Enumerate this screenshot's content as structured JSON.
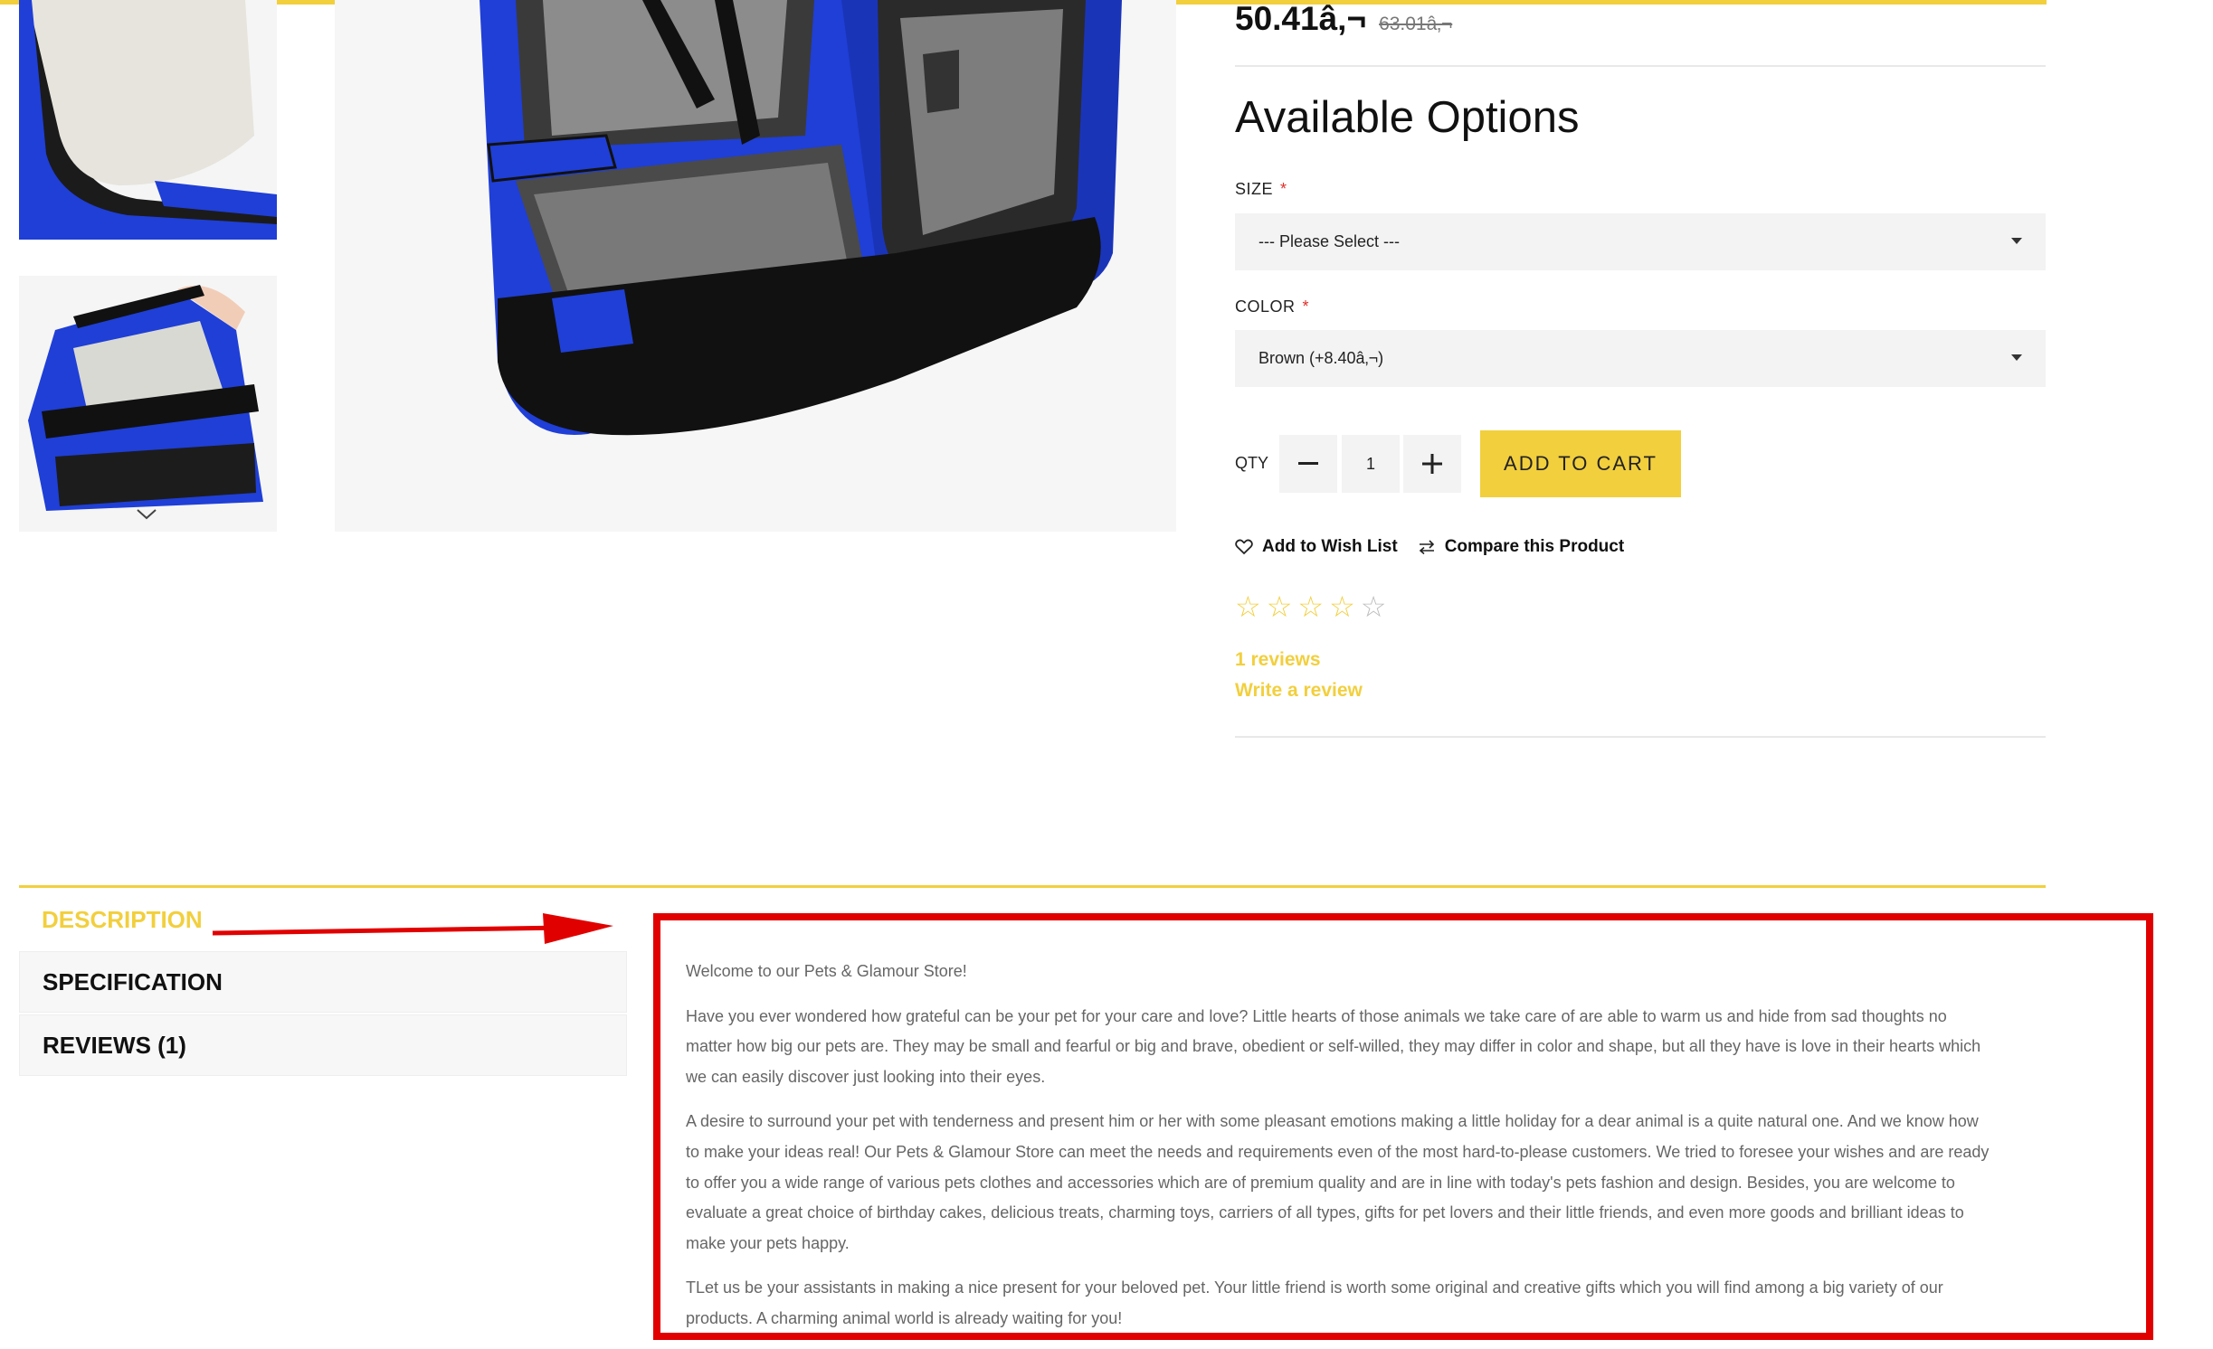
{
  "product": {
    "price_new": "50.41â‚¬",
    "price_old": "63.01â‚¬"
  },
  "options": {
    "title": "Available Options",
    "size": {
      "label": "SIZE",
      "required": "*",
      "selected": "--- Please Select ---"
    },
    "color": {
      "label": "COLOR",
      "required": "*",
      "selected": "Brown (+8.40â‚¬)"
    }
  },
  "cart": {
    "qty_label": "QTY",
    "qty_value": "1",
    "minus": "−",
    "plus": "+",
    "add_to_cart": "ADD TO CART"
  },
  "actions": {
    "wishlist": "Add to Wish List",
    "compare": "Compare this Product"
  },
  "rating": {
    "value": 0,
    "max": 5,
    "reviews": "1 reviews",
    "write_review": "Write a review"
  },
  "tabs": [
    {
      "label": "DESCRIPTION"
    },
    {
      "label": "SPECIFICATION"
    },
    {
      "label": "REVIEWS (1)"
    }
  ],
  "description": [
    "Welcome to our Pets & Glamour Store!",
    "Have you ever wondered how grateful can be your pet for your care and love? Little hearts of those animals we take care of are able to warm us and hide from sad thoughts no matter how big our pets are. They may be small and fearful or big and brave, obedient or self-willed, they may differ in color and shape, but all they have is love in their hearts which we can easily discover just looking into their eyes.",
    "A desire to surround your pet with tenderness and present him or her with some pleasant emotions making a little holiday for a dear animal is a quite natural one. And we know how to make your ideas real! Our Pets & Glamour Store can meet the needs and requirements even of the most hard-to-please customers. We tried to foresee your wishes and are ready to offer you a wide range of various pets clothes and accessories which are of premium quality and are in line with today's pets fashion and design. Besides, you are welcome to evaluate a great choice of birthday cakes, delicious treats, charming toys, carriers of all types, gifts for pet lovers and their little friends, and even more goods and brilliant ideas to make your pets happy.",
    "TLet us be your assistants in making a nice present for your beloved pet. Your little friend is worth some original and creative gifts which you will find among a big variety of our products. A charming animal world is already waiting for you!"
  ],
  "colors": {
    "accent": "#f2cf3d",
    "highlight_box": "#e10000",
    "carrier_blue": "#1f3fd6"
  },
  "icons": [
    "heart-icon",
    "compare-icon",
    "star-icon",
    "chevron-down-icon",
    "minus-icon",
    "plus-icon"
  ]
}
